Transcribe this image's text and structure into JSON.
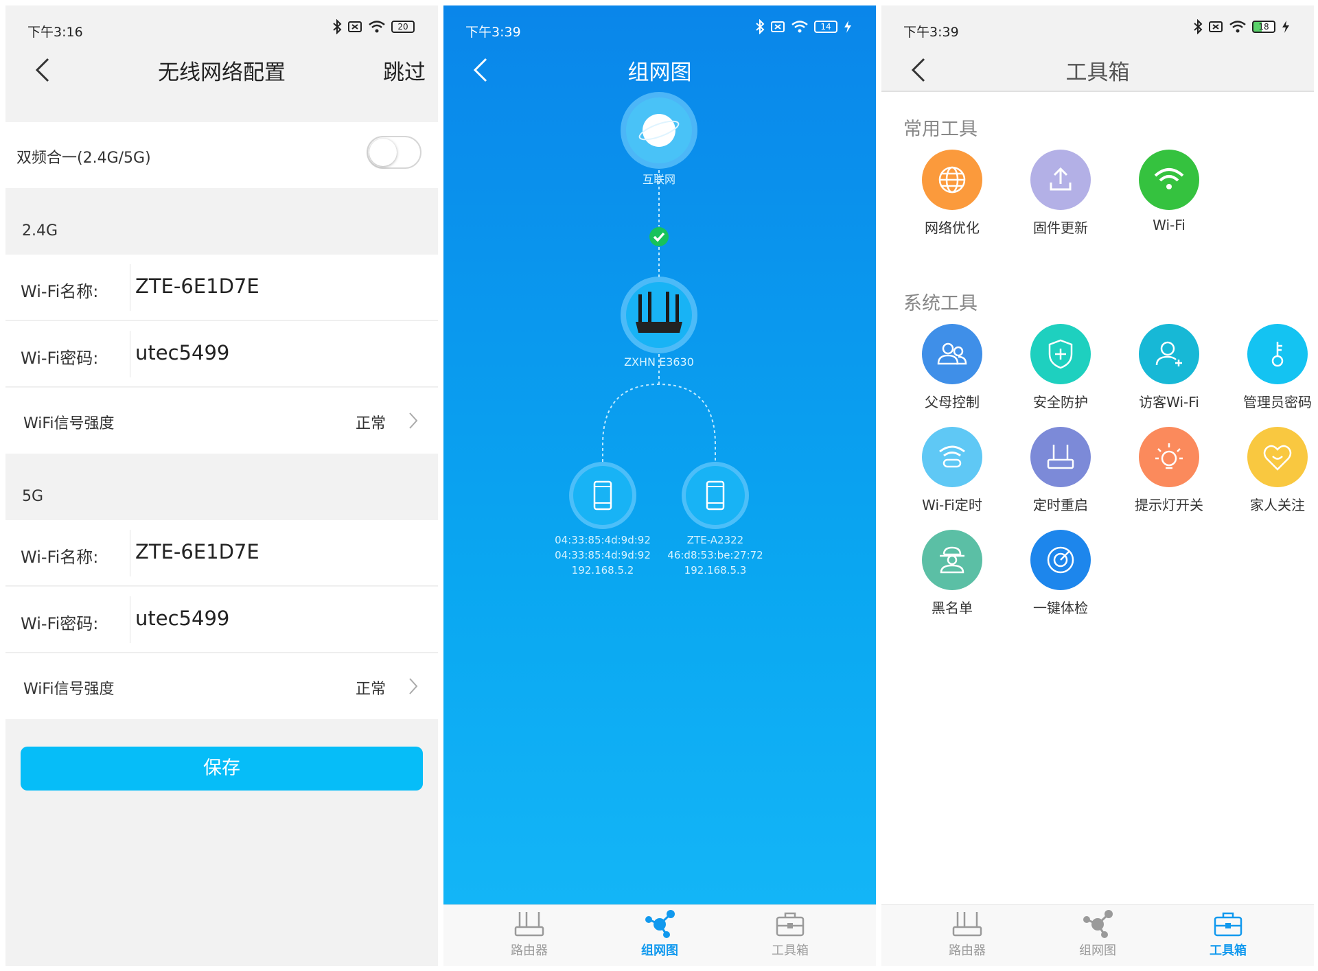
{
  "screen1": {
    "status": {
      "time": "下午3:16",
      "battery": "20"
    },
    "title": "无线网络配置",
    "skip": "跳过",
    "dual_band": {
      "label": "双频合一(2.4G/5G)",
      "enabled": false
    },
    "band24": {
      "section": "2.4G",
      "wifi_name_label": "Wi-Fi名称:",
      "wifi_name": "ZTE-6E1D7E",
      "wifi_pwd_label": "Wi-Fi密码:",
      "wifi_pwd": "utec5499",
      "signal_label": "WiFi信号强度",
      "signal_value": "正常"
    },
    "band5": {
      "section": "5G",
      "wifi_name_label": "Wi-Fi名称:",
      "wifi_name": "ZTE-6E1D7E",
      "wifi_pwd_label": "Wi-Fi密码:",
      "wifi_pwd": "utec5499",
      "signal_label": "WiFi信号强度",
      "signal_value": "正常"
    },
    "save": "保存"
  },
  "screen2": {
    "status": {
      "time": "下午3:39",
      "battery": "14"
    },
    "title": "组网图",
    "internet": "互联网",
    "router": "ZXHN E3630",
    "devices": [
      {
        "line1": "04:33:85:4d:9d:92",
        "line2": "04:33:85:4d:9d:92",
        "line3": "192.168.5.2"
      },
      {
        "line1": "ZTE-A2322",
        "line2": "46:d8:53:be:27:72",
        "line3": "192.168.5.3"
      }
    ],
    "tabs": [
      "路由器",
      "组网图",
      "工具箱"
    ],
    "active_tab": "组网图"
  },
  "screen3": {
    "status": {
      "time": "下午3:39",
      "battery": "18"
    },
    "title": "工具箱",
    "common_title": "常用工具",
    "common_tools": [
      {
        "label": "网络优化",
        "icon": "globe-icon",
        "color": "#fb9a3c"
      },
      {
        "label": "固件更新",
        "icon": "upload-icon",
        "color": "#b3b0e6"
      },
      {
        "label": "Wi-Fi",
        "icon": "wifi-icon",
        "color": "#35c23f"
      }
    ],
    "system_title": "系统工具",
    "system_tools": [
      {
        "label": "父母控制",
        "icon": "parents-icon",
        "color": "#3f8fe8"
      },
      {
        "label": "安全防护",
        "icon": "shield-icon",
        "color": "#1ed0bf"
      },
      {
        "label": "访客Wi-Fi",
        "icon": "guest-icon",
        "color": "#17b8d6"
      },
      {
        "label": "管理员密码",
        "icon": "key-icon",
        "color": "#14c3f2"
      },
      {
        "label": "Wi-Fi定时",
        "icon": "wifi-timer-icon",
        "color": "#5fc8f5"
      },
      {
        "label": "定时重启",
        "icon": "router-restart-icon",
        "color": "#7c8ad8"
      },
      {
        "label": "提示灯开关",
        "icon": "light-icon",
        "color": "#fb8a5c"
      },
      {
        "label": "家人关注",
        "icon": "heart-icon",
        "color": "#f9c840"
      },
      {
        "label": "黑名单",
        "icon": "blacklist-icon",
        "color": "#5bbfa5"
      },
      {
        "label": "一键体检",
        "icon": "checkup-icon",
        "color": "#1d86ec"
      }
    ],
    "tabs": [
      "路由器",
      "组网图",
      "工具箱"
    ],
    "active_tab": "工具箱"
  }
}
